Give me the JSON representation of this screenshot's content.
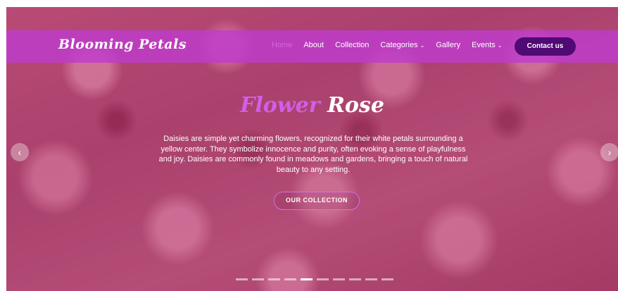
{
  "brand": "Blooming Petals",
  "nav": {
    "items": [
      {
        "label": "Home",
        "active": true
      },
      {
        "label": "About"
      },
      {
        "label": "Collection"
      },
      {
        "label": "Categories",
        "dropdown": true
      },
      {
        "label": "Gallery"
      },
      {
        "label": "Events",
        "dropdown": true
      }
    ],
    "contact_label": "Contact us"
  },
  "hero": {
    "title_word1": "Flower",
    "title_word2": "Rose",
    "description": "Daisies are simple yet charming flowers, recognized for their white petals surrounding a yellow center. They symbolize innocence and purity, often evoking a sense of playfulness and joy. Daisies are commonly found in meadows and gardens, bringing a touch of natural beauty to any setting.",
    "cta_label": "OUR COLLECTION",
    "prev_glyph": "‹",
    "next_glyph": "›",
    "dropdown_glyph": "⌄"
  },
  "colors": {
    "nav_bg": "#be3ccd",
    "accent": "#d25ee8",
    "button_bg": "#4f0a73"
  },
  "icons": {
    "prev": "chevron-left-icon",
    "next": "chevron-right-icon",
    "dropdown": "chevron-down-icon"
  }
}
